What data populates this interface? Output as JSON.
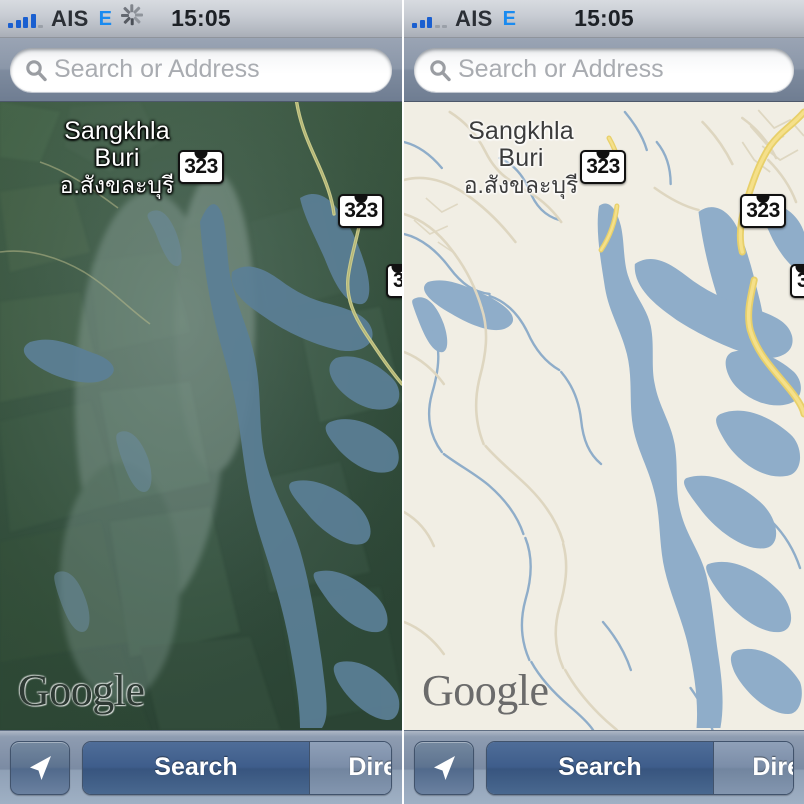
{
  "screens": [
    {
      "id": "satellite",
      "view_mode": "satellite",
      "status": {
        "carrier": "AIS",
        "network": "E",
        "time": "15:05",
        "signal_bars_filled": 4,
        "signal_bars_total": 5,
        "activity_spinner": true
      },
      "search": {
        "placeholder": "Search or Address",
        "value": "",
        "icon": "search-icon"
      },
      "map": {
        "attribution": "Google",
        "place_label_en_line1": "Sangkhla",
        "place_label_en_line2": "Buri",
        "place_label_th": "อ.สังขละบุรี",
        "shields": [
          "323",
          "323",
          "3"
        ],
        "colors": {
          "land": "#3d5a41",
          "water": "#5d7f94",
          "road": "#c9c98a"
        }
      },
      "toolbar": {
        "location_icon": "navigation-arrow-icon",
        "segments": [
          "Search",
          "Directions"
        ],
        "selected_segment": "Search"
      }
    },
    {
      "id": "roadmap",
      "view_mode": "map",
      "status": {
        "carrier": "AIS",
        "network": "E",
        "time": "15:05",
        "signal_bars_filled": 3,
        "signal_bars_total": 5,
        "activity_spinner": false
      },
      "search": {
        "placeholder": "Search or Address",
        "value": "",
        "icon": "search-icon"
      },
      "map": {
        "attribution": "Google",
        "place_label_en_line1": "Sangkhla",
        "place_label_en_line2": "Buri",
        "place_label_th": "อ.สังขละบุรี",
        "shields": [
          "323",
          "323",
          "3"
        ],
        "colors": {
          "land": "#f1eee4",
          "water": "#8fadc9",
          "road": "#f5d44a",
          "minor_road": "#ded6c0"
        }
      },
      "toolbar": {
        "location_icon": "navigation-arrow-icon",
        "segments": [
          "Search",
          "Directions"
        ],
        "selected_segment": "Search"
      }
    }
  ]
}
